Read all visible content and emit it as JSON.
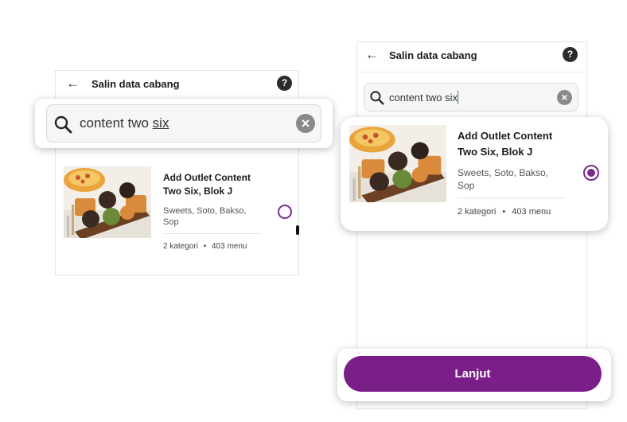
{
  "left": {
    "header": {
      "back_icon": "arrow-left-icon",
      "title": "Salin data cabang",
      "help_label": "?"
    },
    "search": {
      "icon": "search-icon",
      "value_prefix": "content two ",
      "value_underlined": "six",
      "clear_label": "×"
    },
    "outlet": {
      "title_line1": "Add Outlet Content",
      "title_line2": "Two Six, Blok J",
      "categories_line1": "Sweets, Soto, Bakso,",
      "categories_line2": "Sop",
      "kategori": "2 kategori",
      "menu": "403 menu",
      "selected": false
    }
  },
  "right": {
    "header": {
      "back_icon": "arrow-left-icon",
      "title": "Salin data cabang",
      "help_label": "?"
    },
    "search": {
      "icon": "search-icon",
      "value": "content two six",
      "clear_label": "×"
    },
    "outlet": {
      "title_line1": "Add Outlet Content",
      "title_line2": "Two Six, Blok J",
      "categories_line1": "Sweets, Soto, Bakso,",
      "categories_line2": "Sop",
      "kategori": "2 kategori",
      "menu": "403 menu",
      "selected": true
    },
    "continue_button": "Lanjut"
  },
  "colors": {
    "accent": "#7b1f88",
    "radio": "#7b2a8e"
  }
}
